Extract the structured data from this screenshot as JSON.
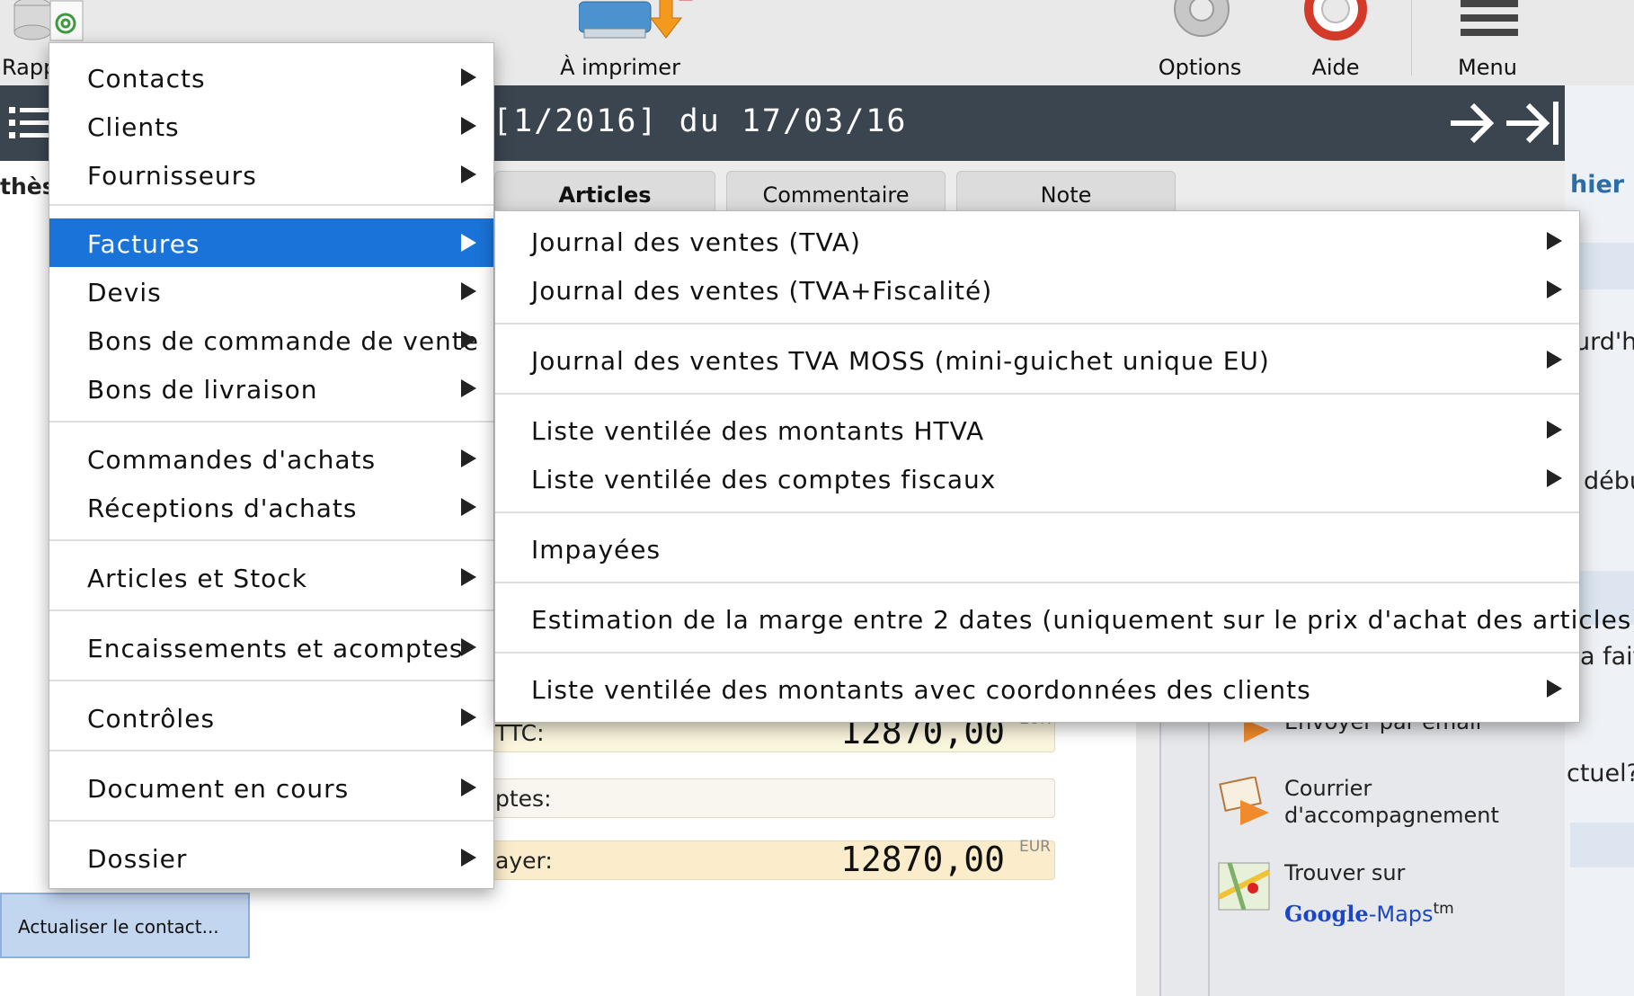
{
  "toolbar": {
    "rapports_label": "Rapp",
    "print_label": "À imprimer",
    "options_label": "Options",
    "aide_label": "Aide",
    "menu_label": "Menu"
  },
  "document": {
    "title": "[1/2016] du 17/03/16"
  },
  "left": {
    "section_label": "thès"
  },
  "tabs": [
    "Articles",
    "Commentaire",
    "Note"
  ],
  "totals": [
    {
      "label": "TTC:",
      "value": "12870,00",
      "currency": "EUR"
    },
    {
      "label": "ptes:",
      "value": "",
      "currency": ""
    },
    {
      "label": "ayer:",
      "value": "12870,00",
      "currency": "EUR"
    }
  ],
  "actions": {
    "email_label": "Envoyer par email",
    "courier_line1": "Courrier",
    "courier_line2": "d'accompagnement",
    "maps_line1": "Trouver sur",
    "maps_google": "Google",
    "maps_sep": "-",
    "maps_maps": "Maps",
    "maps_tm": "tm"
  },
  "far_right": {
    "t1": "hier",
    "t2": "urd'h",
    "t3": "débu",
    "t4": "a fait",
    "t5": "ctuel?"
  },
  "refresh_button": "Actualiser le contact...",
  "main_menu": {
    "items": [
      {
        "label": "Contacts",
        "submenu": true
      },
      {
        "label": "Clients",
        "submenu": true
      },
      {
        "label": "Fournisseurs",
        "submenu": true
      },
      {
        "label": "Factures",
        "submenu": true,
        "selected": true
      },
      {
        "label": "Devis",
        "submenu": true
      },
      {
        "label": "Bons de commande de vente",
        "submenu": true
      },
      {
        "label": "Bons de livraison",
        "submenu": true
      },
      {
        "label": "Commandes d'achats",
        "submenu": true
      },
      {
        "label": "Réceptions d'achats",
        "submenu": true
      },
      {
        "label": "Articles et Stock",
        "submenu": true
      },
      {
        "label": "Encaissements et acomptes",
        "submenu": true
      },
      {
        "label": "Contrôles",
        "submenu": true
      },
      {
        "label": "Document en cours",
        "submenu": true
      },
      {
        "label": "Dossier",
        "submenu": true
      }
    ]
  },
  "factures_submenu": {
    "items": [
      {
        "label": "Journal des ventes (TVA)",
        "submenu": true
      },
      {
        "label": "Journal des ventes (TVA+Fiscalité)",
        "submenu": true
      },
      {
        "label": "Journal des ventes TVA MOSS (mini-guichet unique EU)",
        "submenu": true
      },
      {
        "label": "Liste ventilée des montants HTVA",
        "submenu": true
      },
      {
        "label": "Liste ventilée des comptes fiscaux",
        "submenu": true
      },
      {
        "label": "Impayées",
        "submenu": false
      },
      {
        "label": "Estimation de la marge entre 2 dates (uniquement sur le prix d'achat des articles)",
        "submenu": false
      },
      {
        "label": "Liste ventilée des montants avec coordonnées des clients",
        "submenu": true
      }
    ]
  },
  "colors": {
    "header_bg": "#3a4550",
    "selection": "#1a73d8"
  }
}
